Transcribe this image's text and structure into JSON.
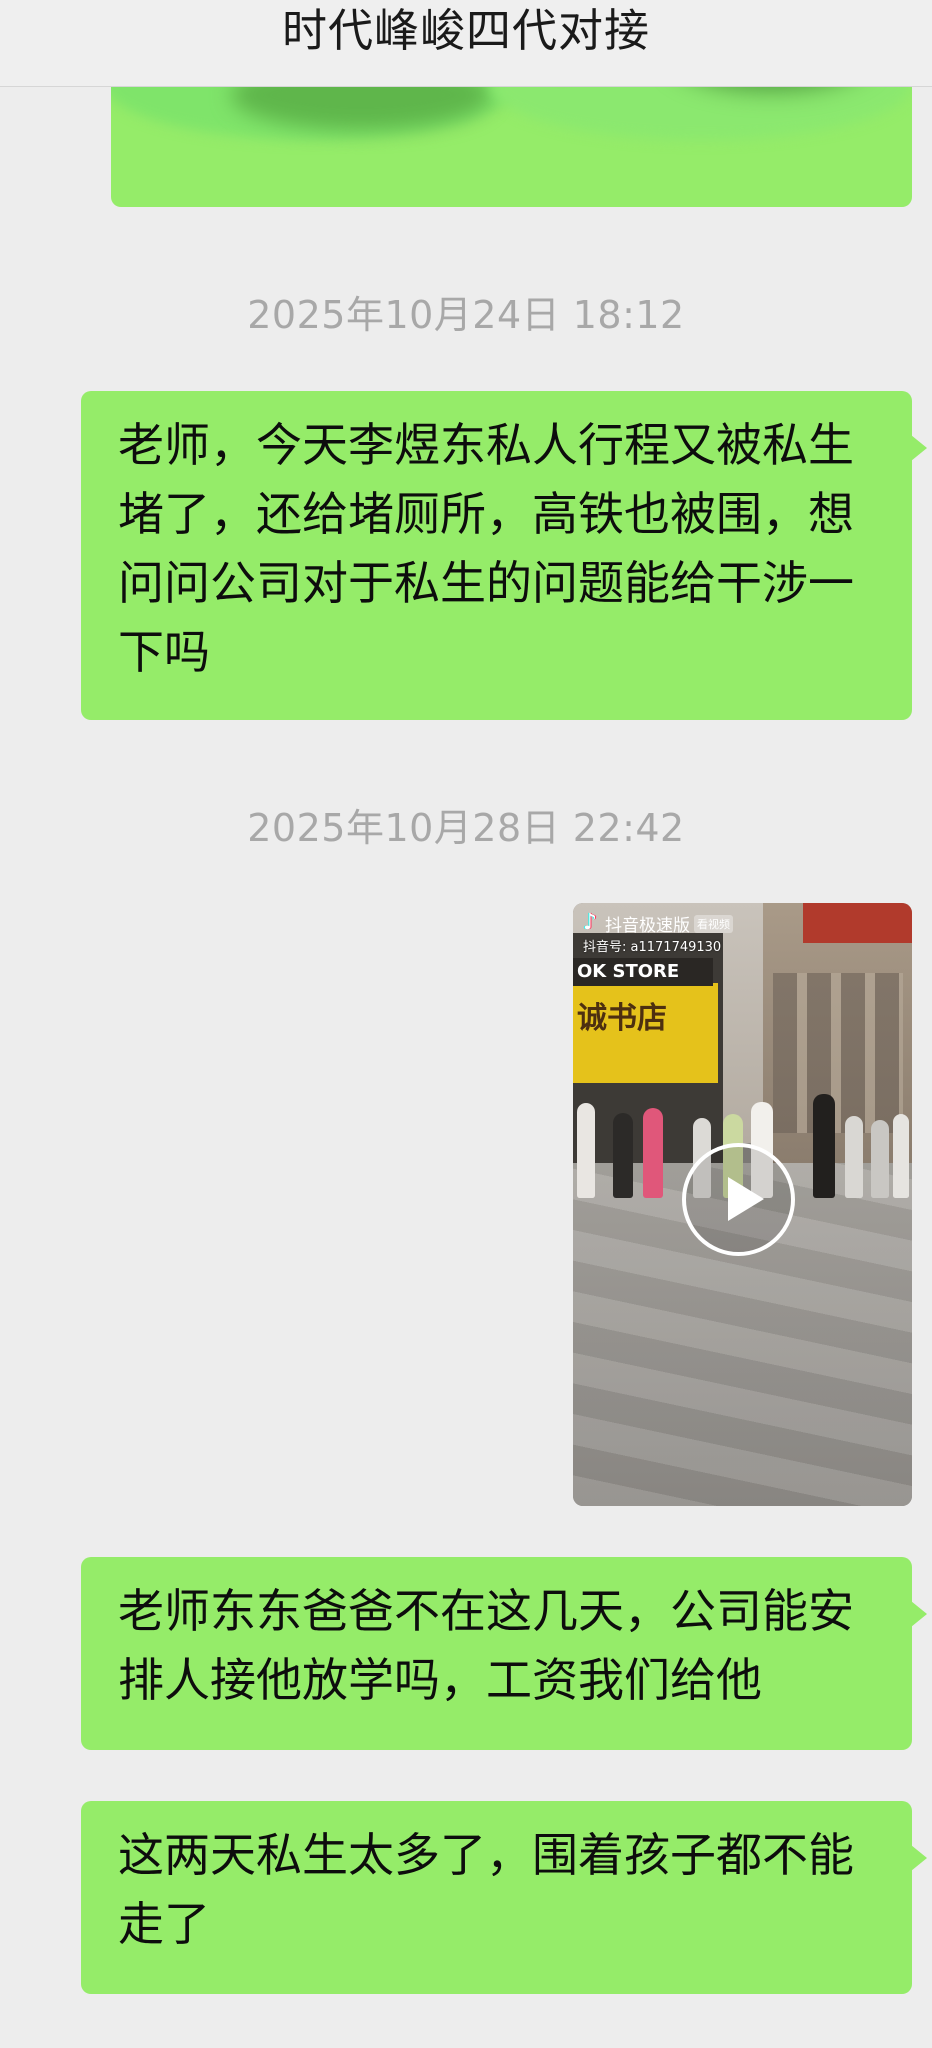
{
  "chat": {
    "title": "时代峰峻四代对接"
  },
  "messages": [
    {
      "kind": "text",
      "content_visible": false
    },
    {
      "kind": "timestamp",
      "text": "2025年10月24日 18:12"
    },
    {
      "kind": "text",
      "text": "老师，今天李煜东私人行程又被私生堵了，还给堵厕所，高铁也被围，想问问公司对于私生的问题能给干涉一下吗"
    },
    {
      "kind": "timestamp",
      "text": "2025年10月28日 22:42"
    },
    {
      "kind": "video",
      "app_name": "抖音极速版",
      "badge": "看视频",
      "account": "抖音号: a1171749130",
      "store_sign": "OK STORE",
      "shop_name": "诚书店"
    },
    {
      "kind": "text",
      "text": "老师东东爸爸不在这几天，公司能安排人接他放学吗，工资我们给他"
    },
    {
      "kind": "text",
      "text": "这两天私生太多了，围着孩子都不能走了"
    }
  ],
  "colors": {
    "background": "#ededed",
    "outgoing_bubble": "#95ec69",
    "timestamp_text": "#a8a8a8"
  }
}
